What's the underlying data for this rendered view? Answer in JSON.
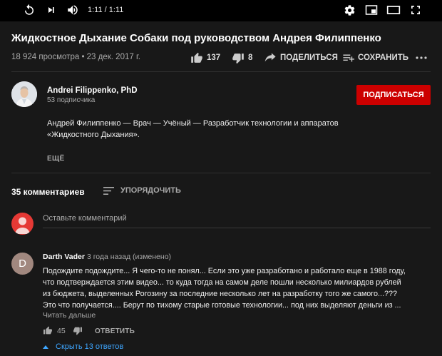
{
  "player": {
    "time": "1:11 / 1:11"
  },
  "video": {
    "title": "Жидкостное Дыхание Собаки под руководством Андрея Филиппенко",
    "views_date": "18 924 просмотра • 23 дек. 2017 г.",
    "likes": "137",
    "dislikes": "8",
    "share_label": "ПОДЕЛИТЬСЯ",
    "save_label": "СОХРАНИТЬ"
  },
  "channel": {
    "name": "Andrei Filippenko, PhD",
    "subscribers": "53 подписчика",
    "subscribe_label": "ПОДПИСАТЬСЯ",
    "description_lines": [
      "Андрей Филиппенко — Врач — Учёный — Разработчик технологии и аппаратов",
      "«Жидкостного Дыхания»."
    ],
    "more_label": "ЕЩЁ"
  },
  "comments": {
    "count_label": "35 комментариев",
    "sort_label": "УПОРЯДОЧИТЬ",
    "add_placeholder": "Оставьте комментарий",
    "items": [
      {
        "avatar_letter": "D",
        "author": "Darth Vader",
        "meta": "3 года назад (изменено)",
        "lines": [
          "Подождите подождите... Я чего-то не понял... Если это уже разработано и работало еще в 1988 году,",
          "что подтверждается этим видео... то куда тогда на самом деле пошли несколько милиардов рублей",
          "из бюджета, выделенных Рогозину за последние несколько лет на разработку того же самого...???",
          "Это что получается.... Берут по тихому старые готовые технологии... под них выделяют деньги из ..."
        ],
        "read_more": "Читать дальше",
        "likes": "45",
        "reply_label": "ОТВЕТИТЬ",
        "show_replies": "Скрыть 13 ответов"
      }
    ]
  },
  "colors": {
    "background": "#181818",
    "subscribe": "#cc0000",
    "link": "#3ea6ff",
    "comment_avatar": "#a1887f",
    "user_avatar": "#e53935"
  },
  "icons": [
    "replay-icon",
    "next-icon",
    "volume-icon",
    "settings-icon",
    "miniplayer-icon",
    "theater-icon",
    "fullscreen-icon",
    "thumbs-up-icon",
    "thumbs-down-icon",
    "share-icon",
    "playlist-add-icon",
    "more-icon",
    "sort-icon",
    "caret-up-icon"
  ]
}
